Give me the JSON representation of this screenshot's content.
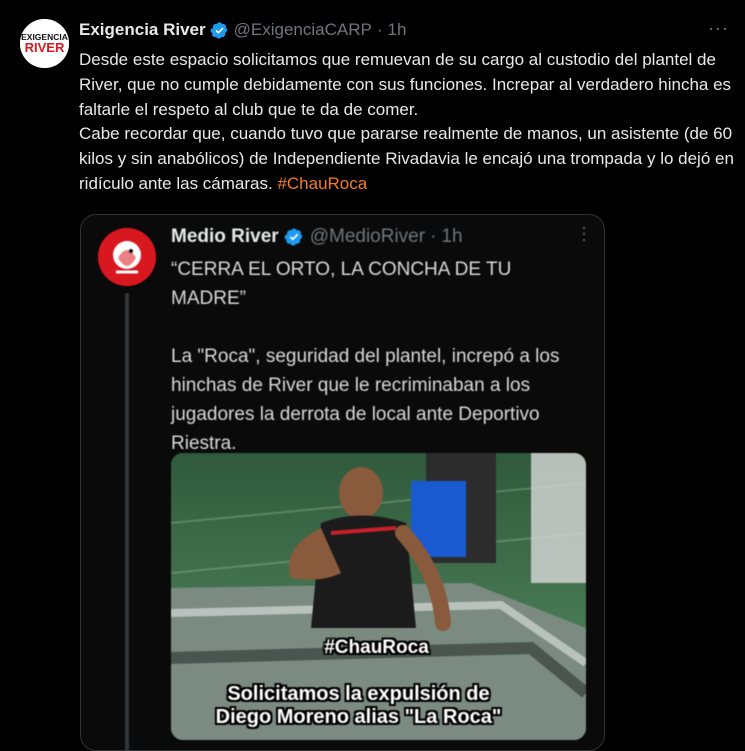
{
  "tweet": {
    "author_name": "Exigencia River",
    "author_handle": "@ExigenciaCARP",
    "separator": "·",
    "time": "1h",
    "more_label": "···",
    "avatar_text_top": "EXIGENCIA",
    "avatar_text_bottom": "RIVER",
    "body_paragraph_1": "Desde este espacio solicitamos que remuevan de su cargo al custodio del plantel de River, que no cumple debidamente con sus funciones. Increpar al verdadero hincha es faltarle el respeto al club que te da de comer.",
    "body_paragraph_2": "Cabe recordar que, cuando tuvo que pararse realmente de manos, un asistente (de 60 kilos y sin anabólicos) de Independiente Rivadavia le encajó una trompada y lo dejó en ridículo ante las cámaras.",
    "hashtag": "#ChauRoca",
    "accent_color": "#f07b2b",
    "verified_color": "#1d9bf0"
  },
  "quoted": {
    "author_name": "Medio River",
    "author_handle": "@MedioRiver",
    "separator": "·",
    "time": "1h",
    "more_label": "···",
    "quote_line": "“CERRA EL ORTO, LA CONCHA DE TU MADRE”",
    "body": "La \"Roca\", seguridad del plantel, increpó a los hinchas de River que le recriminaban a los jugadores la derrota de local ante Deportivo Riestra.",
    "video": {
      "hashtag_overlay": "#ChauRoca",
      "caption_line_1": "Solicitamos la expulsión de",
      "caption_line_2": "Diego Moreno alias \"La Roca\""
    }
  },
  "icons": {
    "verified": "verified-badge-icon",
    "more": "more-dots-icon"
  }
}
